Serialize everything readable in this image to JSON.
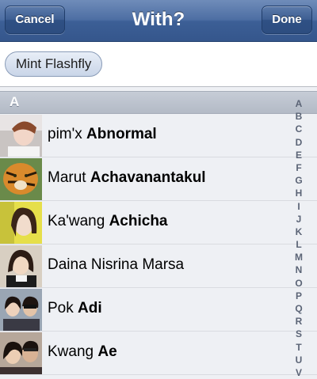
{
  "navbar": {
    "title": "With?",
    "cancel_label": "Cancel",
    "done_label": "Done"
  },
  "selected": {
    "token_label": "Mint Flashfly"
  },
  "section": {
    "letter": "A"
  },
  "contacts": [
    {
      "first": "pim'x",
      "last": "Abnormal"
    },
    {
      "first": "Marut",
      "last": "Achavanantakul"
    },
    {
      "first": "Ka'wang",
      "last": "Achicha"
    },
    {
      "first": "Daina Nisrina Marsa",
      "last": ""
    },
    {
      "first": "Pok",
      "last": "Adi"
    },
    {
      "first": "Kwang",
      "last": "Ae"
    }
  ],
  "index_letters": [
    "A",
    "B",
    "C",
    "D",
    "E",
    "F",
    "G",
    "H",
    "I",
    "J",
    "K",
    "L",
    "M",
    "N",
    "O",
    "P",
    "Q",
    "R",
    "S",
    "T",
    "U",
    "V"
  ],
  "colors": {
    "nav_blue": "#4d6ea3",
    "section_gray": "#b3bac6"
  }
}
